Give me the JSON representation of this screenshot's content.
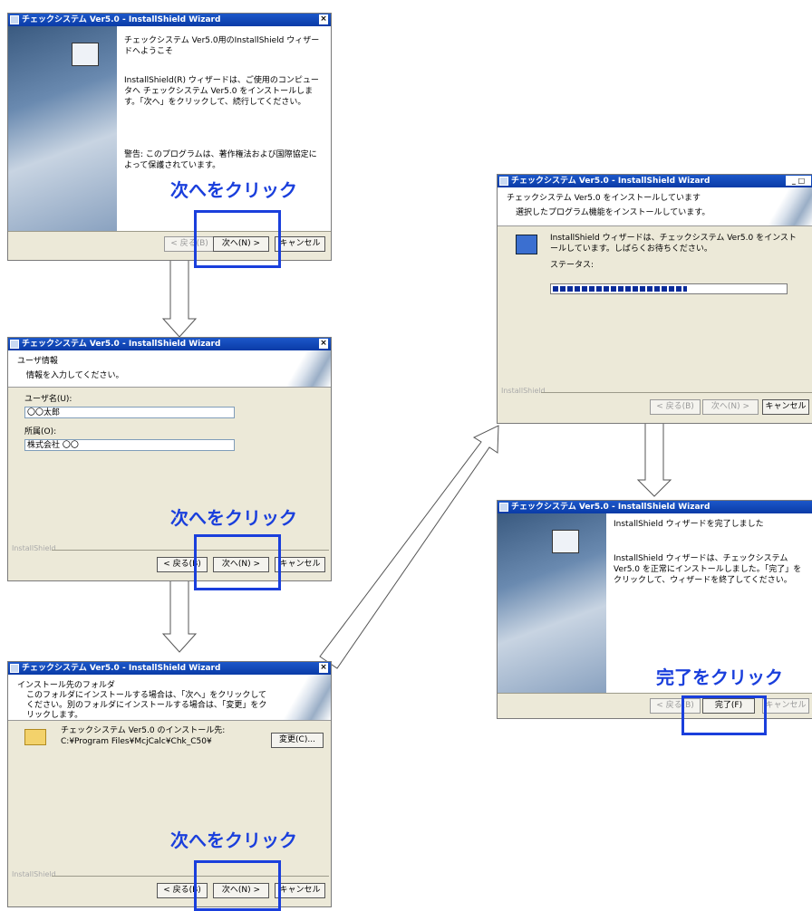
{
  "window_title": "チェックシステム Ver5.0 - InstallShield Wizard",
  "brand": "InstallShield",
  "buttons": {
    "back": "< 戻る(B)",
    "next": "次へ(N) >",
    "cancel": "キャンセル",
    "finish": "完了(F)",
    "change": "変更(C)..."
  },
  "annotations": {
    "next": "次へをクリック",
    "finish": "完了をクリック"
  },
  "welcome": {
    "title": "チェックシステム Ver5.0用のInstallShield ウィザードへようこそ",
    "body": "InstallShield(R) ウィザードは、ご使用のコンピュータへ チェックシステム Ver5.0 をインストールします。「次へ」をクリックして、続行してください。",
    "warning": "警告: このプログラムは、著作権法および国際協定によって保護されています。"
  },
  "userinfo": {
    "header_title": "ユーザ情報",
    "header_sub": "情報を入力してください。",
    "user_label": "ユーザ名(U):",
    "user_value": "〇〇太郎",
    "org_label": "所属(O):",
    "org_value": "株式会社 〇〇"
  },
  "folder": {
    "header_title": "インストール先のフォルダ",
    "header_sub": "このフォルダにインストールする場合は、「次へ」をクリックしてください。別のフォルダにインストールする場合は、「変更」をクリックします。",
    "install_label": "チェックシステム Ver5.0 のインストール先:",
    "install_path": "C:¥Program Files¥McjCalc¥Chk_C50¥"
  },
  "installing": {
    "header_title": "チェックシステム Ver5.0 をインストールしています",
    "header_sub": "選択したプログラム機能をインストールしています。",
    "body": "InstallShield ウィザードは、チェックシステム Ver5.0 をインストールしています。しばらくお待ちください。",
    "status_label": "ステータス:",
    "progress": 0.58
  },
  "complete": {
    "title": "InstallShield ウィザードを完了しました",
    "body": "InstallShield ウィザードは、チェックシステム Ver5.0 を正常にインストールしました。「完了」をクリックして、ウィザードを終了してください。"
  }
}
